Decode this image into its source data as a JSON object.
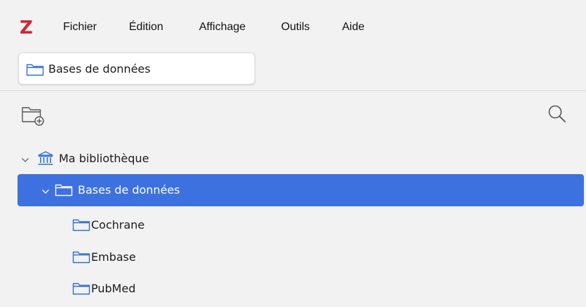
{
  "app": {
    "logo": "Z"
  },
  "menu": [
    "Fichier",
    "Édition",
    "Affichage",
    "Outils",
    "Aide"
  ],
  "tab": {
    "label": "Bases de données",
    "icon": "folder-icon"
  },
  "toolbar": {
    "new_collection_icon": "new-collection-icon",
    "search_icon": "search-icon"
  },
  "tree": {
    "library": {
      "label": "Ma bibliothèque",
      "icon": "library-icon",
      "expanded": true
    },
    "selected": {
      "label": "Bases de données",
      "icon": "folder-icon",
      "expanded": true
    },
    "children": [
      {
        "label": "Cochrane",
        "icon": "folder-icon"
      },
      {
        "label": "Embase",
        "icon": "folder-icon"
      },
      {
        "label": "PubMed",
        "icon": "folder-icon"
      }
    ]
  },
  "colors": {
    "accent": "#3d71e0",
    "logo": "#cc2936",
    "background": "#f2f2f2"
  }
}
